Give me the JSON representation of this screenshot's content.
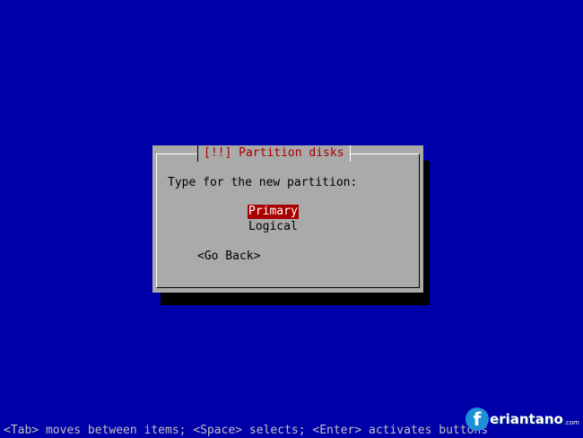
{
  "dialog": {
    "title": "[!!] Partition disks",
    "prompt": "Type for the new partition:",
    "options": [
      {
        "label": "Primary",
        "selected": true
      },
      {
        "label": "Logical",
        "selected": false
      }
    ],
    "back_button": "<Go Back>"
  },
  "help_line": "<Tab> moves between items; <Space> selects; <Enter> activates buttons",
  "watermark": {
    "logo_glyph": "f",
    "text": "eriantano",
    "suffix": ".com"
  },
  "colors": {
    "background": "#0000a8",
    "dialog": "#aaaaaa",
    "title": "#a80000",
    "selection": "#a80000"
  }
}
